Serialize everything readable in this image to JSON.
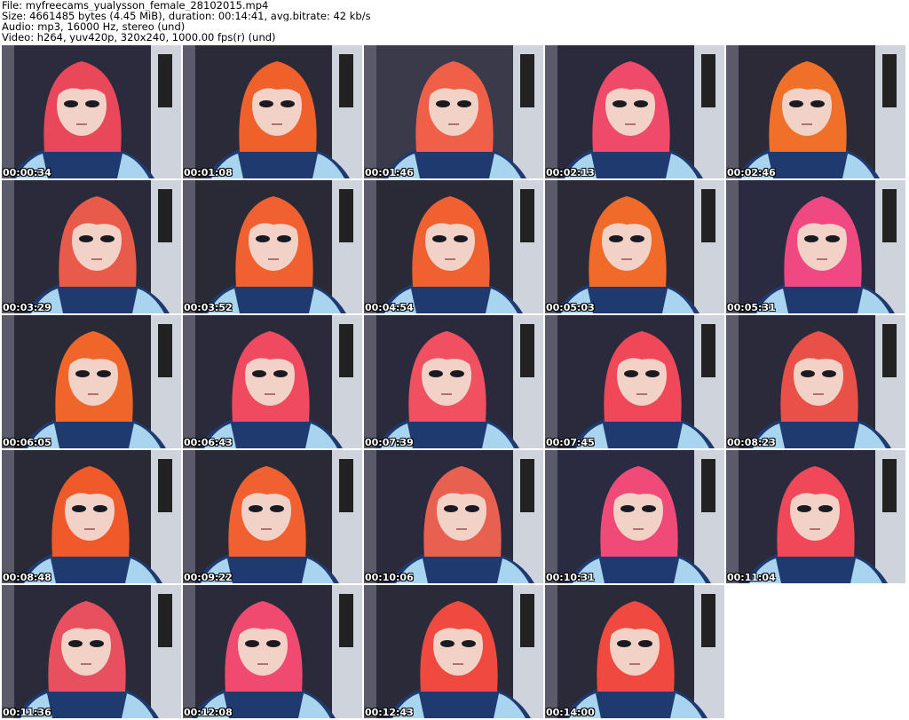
{
  "header": {
    "file_line": "File: myfreecams_yualysson_female_28102015.mp4",
    "size_line": "Size: 4661485 bytes (4.45 MiB), duration: 00:14:41, avg.bitrate: 42 kb/s",
    "audio_line": "Audio: mp3, 16000 Hz, stereo (und)",
    "video_line": "Video: h264, yuv420p, 320x240, 1000.00 fps(r) (und)"
  },
  "thumbnails": [
    {
      "timestamp": "00:00:34",
      "hair": "#e8485a",
      "bg": "#2b2b3d"
    },
    {
      "timestamp": "00:01:08",
      "hair": "#f0602a",
      "bg": "#2a2a38"
    },
    {
      "timestamp": "00:01:46",
      "hair": "#f06048",
      "bg": "#3a3a4a"
    },
    {
      "timestamp": "00:02:13",
      "hair": "#f04a6a",
      "bg": "#2a2a3c"
    },
    {
      "timestamp": "00:02:46",
      "hair": "#f0702a",
      "bg": "#2c2a36"
    },
    {
      "timestamp": "00:03:29",
      "hair": "#e85a4a",
      "bg": "#2a2a3a"
    },
    {
      "timestamp": "00:03:52",
      "hair": "#f06030",
      "bg": "#2a2a36"
    },
    {
      "timestamp": "00:04:54",
      "hair": "#f06030",
      "bg": "#2a2a36"
    },
    {
      "timestamp": "00:05:03",
      "hair": "#f06a2a",
      "bg": "#2c2a36"
    },
    {
      "timestamp": "00:05:31",
      "hair": "#f04880",
      "bg": "#2a2a40"
    },
    {
      "timestamp": "00:06:05",
      "hair": "#f0652a",
      "bg": "#2a2a36"
    },
    {
      "timestamp": "00:06:43",
      "hair": "#f04a60",
      "bg": "#2b2a3a"
    },
    {
      "timestamp": "00:07:39",
      "hair": "#f05060",
      "bg": "#2a2a3c"
    },
    {
      "timestamp": "00:07:45",
      "hair": "#f04858",
      "bg": "#2a2a3c"
    },
    {
      "timestamp": "00:08:23",
      "hair": "#e85048",
      "bg": "#2a2a3a"
    },
    {
      "timestamp": "00:08:48",
      "hair": "#f05a2a",
      "bg": "#2a2a36"
    },
    {
      "timestamp": "00:09:22",
      "hair": "#f06030",
      "bg": "#2a2a36"
    },
    {
      "timestamp": "00:10:06",
      "hair": "#e86050",
      "bg": "#2a2a3c"
    },
    {
      "timestamp": "00:10:31",
      "hair": "#f04a78",
      "bg": "#2a2a40"
    },
    {
      "timestamp": "00:11:04",
      "hair": "#f04858",
      "bg": "#2a2a3c"
    },
    {
      "timestamp": "00:11:36",
      "hair": "#e85060",
      "bg": "#2a2a3a"
    },
    {
      "timestamp": "00:12:08",
      "hair": "#f04a70",
      "bg": "#2a2a3a"
    },
    {
      "timestamp": "00:12:43",
      "hair": "#f04a40",
      "bg": "#2a2a38"
    },
    {
      "timestamp": "00:14:00",
      "hair": "#f04a40",
      "bg": "#2a2a38"
    }
  ]
}
